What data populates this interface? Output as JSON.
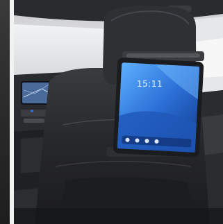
{
  "photo": {
    "subject": "car-interior-headrest-tablet-mount",
    "tablet_clock": "15:11"
  },
  "colors": {
    "tablet_screen": "#2b6fd6",
    "tablet_bezel": "#1b1c1f",
    "seat_leather": "#2e2f33",
    "headliner": "#d8d9db"
  }
}
